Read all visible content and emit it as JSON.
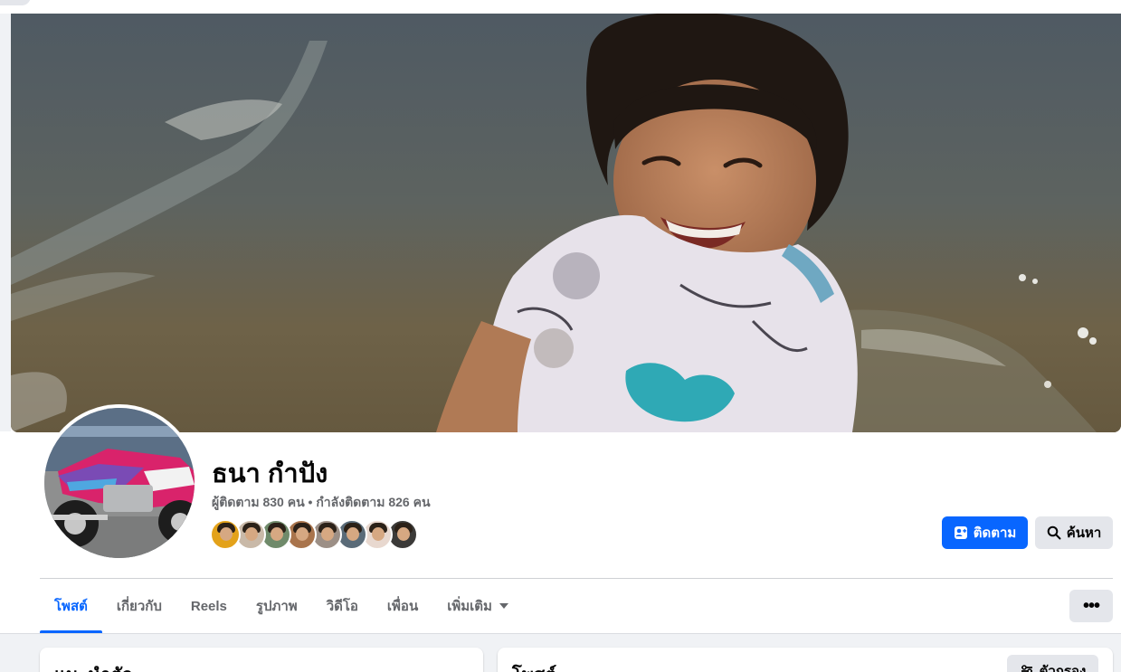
{
  "profile": {
    "name": "ธนา กำปัง",
    "followers_text": "ผู้ติดตาม 830 คน • กำลังติดตาม 826 คน",
    "follow_button": "ติดตาม",
    "search_button": "ค้นหา",
    "friend_avatars": [
      {
        "bg": "#e3a21a"
      },
      {
        "bg": "#c9b9a8"
      },
      {
        "bg": "#6f8a6a"
      },
      {
        "bg": "#a9744c"
      },
      {
        "bg": "#9c8f86"
      },
      {
        "bg": "#5a6b78"
      },
      {
        "bg": "#e8d8cf"
      },
      {
        "bg": "#3b3a38"
      }
    ]
  },
  "tabs": [
    {
      "label": "โพสต์",
      "active": true,
      "name": "tab-posts"
    },
    {
      "label": "เกี่ยวกับ",
      "active": false,
      "name": "tab-about"
    },
    {
      "label": "Reels",
      "active": false,
      "name": "tab-reels"
    },
    {
      "label": "รูปภาพ",
      "active": false,
      "name": "tab-photos"
    },
    {
      "label": "วิดีโอ",
      "active": false,
      "name": "tab-videos"
    },
    {
      "label": "เพื่อน",
      "active": false,
      "name": "tab-friends"
    },
    {
      "label": "เพิ่มเติม",
      "active": false,
      "name": "tab-more",
      "dropdown": true
    }
  ],
  "more_button": "•••",
  "intro_card": {
    "title": "แนะนำตัว"
  },
  "posts_card": {
    "title": "โพสต์",
    "filter_button": "ตัวกรอง"
  },
  "colors": {
    "accent": "#0866ff",
    "secondary_button": "#e4e6eb",
    "muted_text": "#65676b",
    "page_bg": "#f0f2f5"
  },
  "icons": {
    "follow": "person-add-icon",
    "search": "search-icon",
    "filter": "filter-sliders-icon",
    "more": "more-dots-icon",
    "dropdown": "caret-down-icon"
  }
}
